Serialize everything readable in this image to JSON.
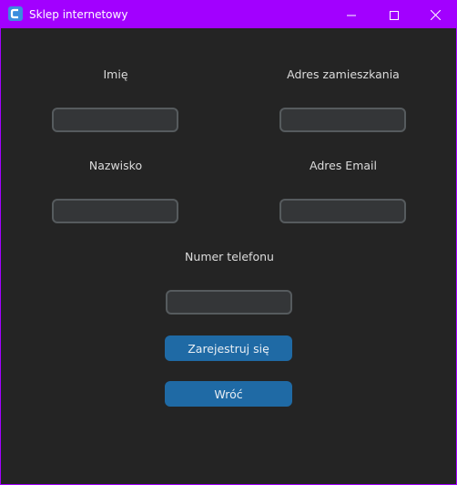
{
  "window": {
    "title": "Sklep internetowy",
    "accent_color": "#a200ff",
    "icons": {
      "app": "app-logo-icon",
      "minimize": "minimize-icon",
      "maximize": "maximize-icon",
      "close": "close-icon"
    }
  },
  "form": {
    "first_name": {
      "label": "Imię",
      "value": "",
      "placeholder": ""
    },
    "address": {
      "label": "Adres zamieszkania",
      "value": "",
      "placeholder": ""
    },
    "last_name": {
      "label": "Nazwisko",
      "value": "",
      "placeholder": ""
    },
    "email": {
      "label": "Adres Email",
      "value": "",
      "placeholder": ""
    },
    "phone": {
      "label": "Numer telefonu",
      "value": "",
      "placeholder": ""
    }
  },
  "buttons": {
    "register": "Zarejestruj się",
    "back": "Wróć",
    "color": "#1f6aa5"
  }
}
